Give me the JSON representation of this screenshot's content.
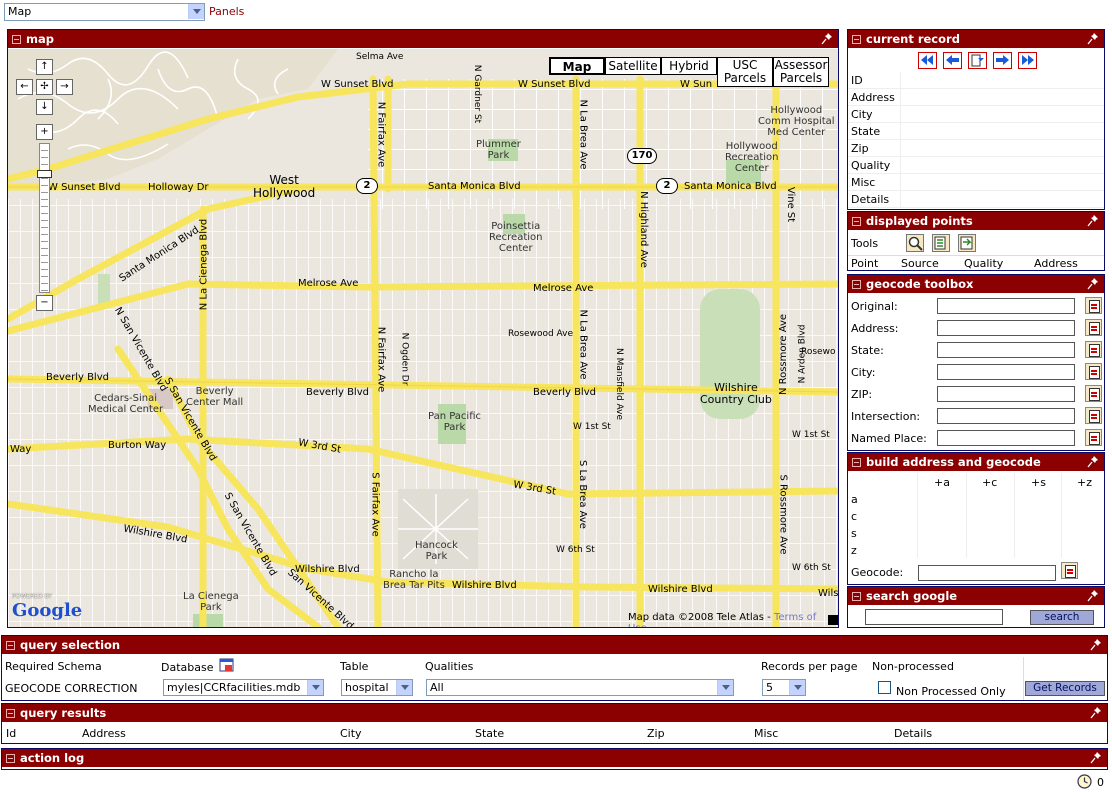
{
  "top": {
    "view_select": "Map",
    "panels_link": "Panels"
  },
  "map_panel": {
    "title": "map",
    "map_types": [
      "Map",
      "Satellite",
      "Hybrid",
      "USC Parcels",
      "Assessor Parcels"
    ],
    "nav": {
      "up": "↑",
      "down": "↓",
      "left": "←",
      "right": "→",
      "center": "✢",
      "zoom_in": "+",
      "zoom_out": "−"
    },
    "copyright": "Map data ©2008 Tele Atlas - ",
    "terms": "Terms of Use",
    "powered_by": "POWERED BY",
    "google_logo": "Google",
    "labels": {
      "w_sunset_top": "W Sunset Blvd",
      "w_sunset_top2": "W Sun",
      "selma": "Selma Ave",
      "w_sunset_left": "W Sunset Blvd",
      "holloway": "Holloway Dr",
      "west_hollywood": "West\nHollywood",
      "santa_monica_1": "Santa Monica Blvd",
      "santa_monica_2": "Santa Monica Blvd",
      "santa_monica_diag": "Santa Monica Blvd",
      "plummer": "Plummer\nPark",
      "hollywood_hosp": "Hollywood\nComm Hospital\nMed Center",
      "hollywood_rec": "Hollywood\nRecreation\nCenter",
      "poinsettia": "Poinsettia\nRecreation\nCenter",
      "melrose_1": "Melrose Ave",
      "melrose_2": "Melrose Ave",
      "rosewood": "Rosewood Ave",
      "rosewood_r": "Rosewo",
      "beverly_left": "Beverly Blvd",
      "beverly_1": "Beverly Blvd",
      "beverly_2": "Beverly Blvd",
      "cedars": "Cedars-Sinai\nMedical Center",
      "beverly_center": "Beverly\nCenter Mall",
      "pan_pacific": "Pan Pacific\nPark",
      "wilshire_cc": "Wilshire\nCountry Club",
      "w1st": "W 1st St",
      "w1st_r": "W 1st St",
      "burton": "Burton Way",
      "way": "Way",
      "w3rd_1": "W 3rd St",
      "w3rd_2": "W 3rd St",
      "hancock": "Hancock\nPark",
      "w6th": "W 6th St",
      "w6th_r": "W 6th St",
      "wilshire_1": "Wilshire Blvd",
      "wilshire_2": "Wilshire Blvd",
      "wilshire_3": "Wilshire Blvd",
      "wilshire_4": "Wilshire Blvd",
      "wilshire_r": "Wils",
      "rancho": "Rancho la\nBrea Tar Pits",
      "la_cienega_park": "La Cienega\nPark",
      "san_vicente": "San Vicente Blvd",
      "n_fairfax": "N Fairfax Ave",
      "s_fairfax": "S Fairfax Ave",
      "n_la_brea": "N La Brea Ave",
      "s_la_brea": "S La Brea Ave",
      "n_highland": "N Highland Ave",
      "n_gardner": "N Gardner St",
      "vine": "Vine St",
      "n_rossmore": "N Rossmore Ave",
      "s_rossmore": "S Rossmore Ave",
      "n_la_cienega": "N La Cienega Blvd",
      "n_san_vicente": "N San Vicente Blvd",
      "s_san_vicente": "S San Vicente Blvd",
      "n_ogden": "N Ogden Dr",
      "n_mansfield": "N Mansfield Ave",
      "n_arden": "N Arden Blvd",
      "hwy2a": "2",
      "hwy2b": "2",
      "hwy170": "170"
    }
  },
  "current_record": {
    "title": "current record",
    "fields": [
      "ID",
      "Address",
      "City",
      "State",
      "Zip",
      "Quality",
      "Misc",
      "Details"
    ],
    "nav_icons": [
      "first-record-icon",
      "prev-record-icon",
      "goto-record-icon",
      "next-record-icon",
      "last-record-icon"
    ]
  },
  "displayed_points": {
    "title": "displayed points",
    "tools_label": "Tools",
    "columns": [
      "Point",
      "Source",
      "Quality",
      "Address"
    ]
  },
  "geocode_toolbox": {
    "title": "geocode toolbox",
    "fields": [
      "Original:",
      "Address:",
      "State:",
      "City:",
      "ZIP:",
      "Intersection:",
      "Named Place:"
    ]
  },
  "build_address": {
    "title": "build address and geocode",
    "columns": [
      "+a",
      "+c",
      "+s",
      "+z"
    ],
    "rows": [
      "a",
      "c",
      "s",
      "z"
    ],
    "geocode_label": "Geocode:"
  },
  "search_google": {
    "title": "search google",
    "button": "search",
    "value": ""
  },
  "query_selection": {
    "title": "query selection",
    "required_schema_label": "Required Schema",
    "required_schema_value": "GEOCODE CORRECTION",
    "database_label": "Database",
    "database_value": "myles|CCRfacilities.mdb",
    "table_label": "Table",
    "table_value": "hospital",
    "qualities_label": "Qualities",
    "qualities_value": "All",
    "records_label": "Records per page",
    "records_value": "5",
    "nonprocessed_label": "Non-processed",
    "nonprocessed_only": "Non Processed Only",
    "get_records": "Get Records"
  },
  "query_results": {
    "title": "query results",
    "columns": [
      "Id",
      "Address",
      "City",
      "State",
      "Zip",
      "Misc",
      "Details"
    ]
  },
  "action_log": {
    "title": "action log"
  },
  "status": {
    "count": "0"
  }
}
